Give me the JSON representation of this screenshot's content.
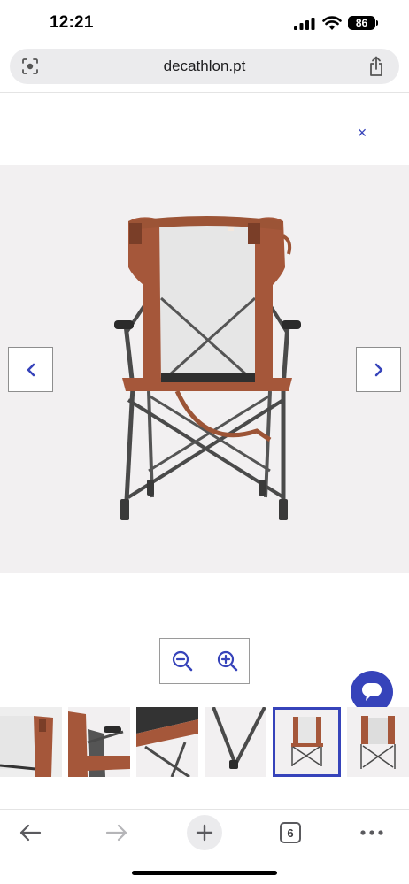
{
  "status_bar": {
    "time": "12:21",
    "battery": "86"
  },
  "browser": {
    "url": "decathlon.pt",
    "open_tabs": "6"
  },
  "viewer": {
    "close_symbol": "×",
    "zoom_out": "zoom-out",
    "zoom_in": "zoom-in",
    "thumbnails": [
      {
        "view": "backrest close-up"
      },
      {
        "view": "armrest side view"
      },
      {
        "view": "frame detail"
      },
      {
        "view": "legs close-up"
      },
      {
        "view": "front view",
        "selected": true
      },
      {
        "view": "rear view"
      }
    ],
    "selected_index": 4
  },
  "colors": {
    "accent": "#3643ba",
    "chair_fabric": "#a5573a",
    "mesh": "#e6e6e6",
    "frame": "#4a4a4a",
    "background": "#f2f0f1"
  }
}
